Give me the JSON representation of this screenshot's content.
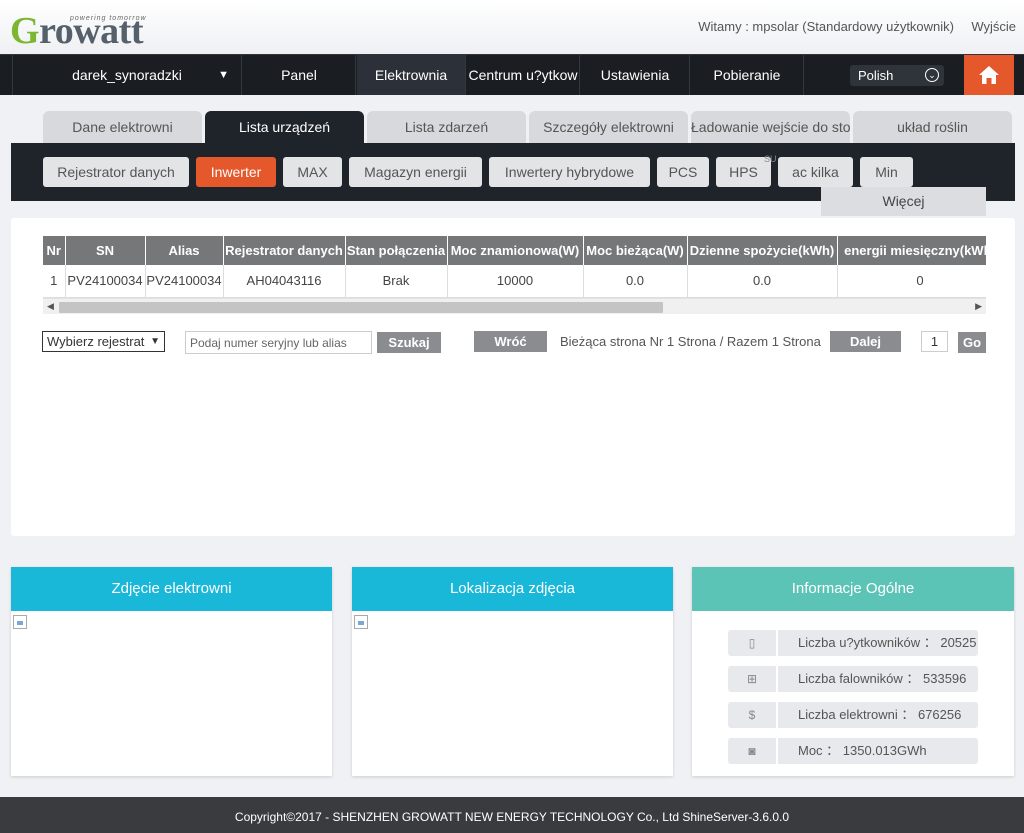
{
  "header": {
    "logo_text": "Growatt",
    "logo_tagline": "powering tomorrow",
    "welcome": "Witamy : mpsolar (Standardowy użytkownik)",
    "logout": "Wyjście"
  },
  "nav": {
    "user": "darek_synoradzki",
    "items": [
      "Panel",
      "Elektrownia",
      "Centrum u?ytkow",
      "Ustawienia",
      "Pobieranie"
    ],
    "active": "Elektrownia",
    "language": "Polish"
  },
  "tabs": [
    "Dane elektrowni",
    "Lista urządzeń",
    "Lista zdarzeń",
    "Szczegóły elektrowni",
    "Ładowanie wejście do sto",
    "układ roślin"
  ],
  "active_tab": "Lista urządzeń",
  "device_tabs": [
    "Rejestrator danych",
    "Inwerter",
    "MAX",
    "Magazyn energii",
    "Inwertery hybrydowe",
    "PCS",
    "HPS",
    "ac kilka",
    "Min"
  ],
  "active_device_tab": "Inwerter",
  "superscript_mark": "SU",
  "more_label": "Więcej",
  "table": {
    "columns": [
      "Nr",
      "SN",
      "Alias",
      "Rejestrator danych",
      "Stan połączenia",
      "Moc znamionowa(W)",
      "Moc bieżąca(W)",
      "Dzienne spożycie(kWh)",
      "energii miesięczny(kWh)"
    ],
    "rows": [
      [
        "1",
        "PV24100034",
        "PV24100034",
        "AH04043116",
        "Brak",
        "10000",
        "0.0",
        "0.0",
        "0"
      ]
    ]
  },
  "controls": {
    "logger_select": "Wybierz rejestrat",
    "search_placeholder": "Podaj numer seryjny lub alias",
    "search_button": "Szukaj",
    "back_button": "Wróć",
    "page_info": "Bieżąca strona  Nr 1 Strona / Razem 1 Strona",
    "next_button": "Dalej",
    "page_number": "1",
    "go_button": "Go"
  },
  "cards": {
    "photo": {
      "title": "Zdjęcie elektrowni",
      "color": "#19b7d8"
    },
    "location": {
      "title": "Lokalizacja zdjęcia",
      "color": "#19b7d8"
    },
    "info": {
      "title": "Informacje Ogólne",
      "color": "#5cc4b7",
      "rows": [
        {
          "icon": "user-phone-icon",
          "text": "Liczba u?ytkowników ： 20525"
        },
        {
          "icon": "solar-panel-icon",
          "text": "Liczba falowników ： 533596"
        },
        {
          "icon": "money-bag-icon",
          "text": "Liczba elektrowni ： 676256"
        },
        {
          "icon": "power-meter-icon",
          "text": "Moc ： 1350.013GWh"
        }
      ]
    }
  },
  "footer": "Copyright©2017 - SHENZHEN GROWATT NEW ENERGY TECHNOLOGY Co., Ltd ShineServer-3.6.0.0",
  "colors": {
    "accent": "#e4582b",
    "dark": "#1f232a"
  }
}
